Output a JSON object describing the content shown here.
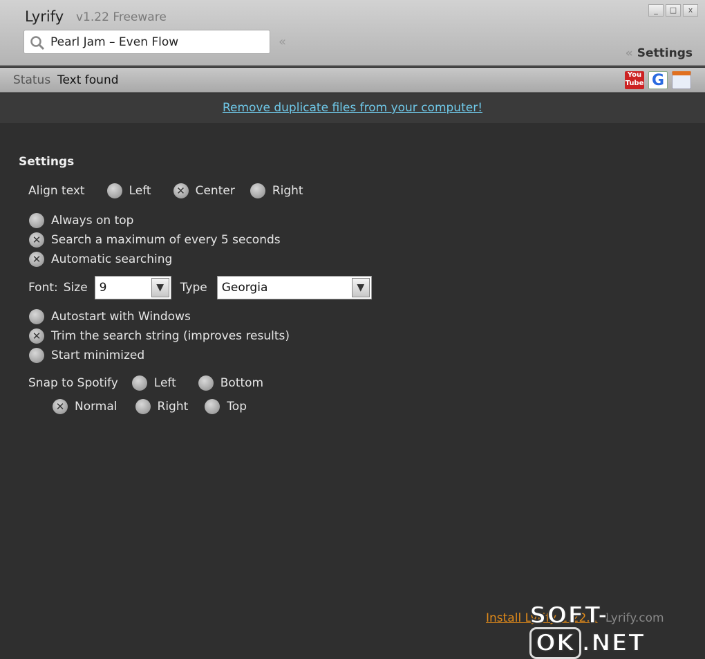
{
  "app": {
    "title": "Lyrify",
    "version": "v1.22 Freeware"
  },
  "window": {
    "minimize": "_",
    "maximize": "□",
    "close": "x"
  },
  "search": {
    "value": "Pearl Jam – Even Flow",
    "collapse": "«"
  },
  "header": {
    "settings_link": "Settings",
    "settings_chevron": "«"
  },
  "status": {
    "label": "Status",
    "value": "Text found"
  },
  "toolbar_icons": [
    {
      "name": "youtube-icon",
      "text": "You Tube"
    },
    {
      "name": "google-icon",
      "text": "G"
    },
    {
      "name": "calendar-icon",
      "text": ""
    }
  ],
  "banner": {
    "link": "Remove duplicate files from your computer!"
  },
  "settings": {
    "title": "Settings",
    "align": {
      "label": "Align text",
      "options": [
        {
          "label": "Left",
          "checked": false
        },
        {
          "label": "Center",
          "checked": true
        },
        {
          "label": "Right",
          "checked": false
        }
      ]
    },
    "group1": [
      {
        "label": "Always on top",
        "checked": false
      },
      {
        "label": "Search a maximum of every 5 seconds",
        "checked": true
      },
      {
        "label": "Automatic searching",
        "checked": true
      }
    ],
    "font": {
      "label": "Font:",
      "size_label": "Size",
      "size_value": "9",
      "type_label": "Type",
      "type_value": "Georgia"
    },
    "group2": [
      {
        "label": "Autostart with Windows",
        "checked": false
      },
      {
        "label": "Trim the search string (improves results)",
        "checked": true
      },
      {
        "label": "Start minimized",
        "checked": false
      }
    ],
    "snap": {
      "label": "Snap to Spotify",
      "options": [
        {
          "label": "Left",
          "checked": false
        },
        {
          "label": "Bottom",
          "checked": false
        },
        {
          "label": "Normal",
          "checked": true
        },
        {
          "label": "Right",
          "checked": false
        },
        {
          "label": "Top",
          "checked": false
        }
      ]
    }
  },
  "footer": {
    "install_link": "Install Lyrify 1.22.1",
    "site": "Lyrify.com"
  },
  "watermark": "SOFT-OK.NET",
  "colors": {
    "link": "#6fc8e8",
    "install": "#e08a1a",
    "background": "#2f2f2f"
  }
}
